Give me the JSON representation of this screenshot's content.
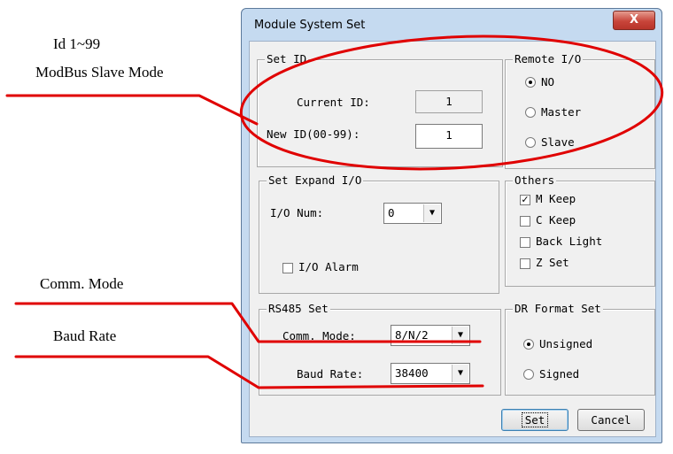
{
  "annotations": {
    "id_range": "Id 1~99",
    "slave_mode": "ModBus Slave Mode",
    "comm_mode": "Comm. Mode",
    "baud_rate": "Baud Rate",
    "line_color": "#e00000"
  },
  "dialog": {
    "title": "Module System Set",
    "close_label": "X",
    "set_id": {
      "title": "Set ID",
      "current_label": "Current ID:",
      "current_value": "1",
      "new_label": "New ID(00-99):",
      "new_value": "1"
    },
    "remote_io": {
      "title": "Remote I/O",
      "options": [
        "NO",
        "Master",
        "Slave"
      ],
      "selected": "NO"
    },
    "expand_io": {
      "title": "Set Expand I/O",
      "num_label": "I/O Num:",
      "num_value": "0",
      "alarm_label": "I/O Alarm"
    },
    "others": {
      "title": "Others",
      "options": [
        "M Keep",
        "C Keep",
        "Back Light",
        "Z Set"
      ],
      "checked": [
        "M Keep"
      ]
    },
    "rs485": {
      "title": "RS485 Set",
      "comm_label": "Comm. Mode:",
      "comm_value": "8/N/2",
      "baud_label": "Baud Rate:",
      "baud_value": "38400"
    },
    "dr_format": {
      "title": "DR Format Set",
      "options": [
        "Unsigned",
        "Signed"
      ],
      "selected": "Unsigned"
    },
    "buttons": {
      "set": "Set",
      "cancel": "Cancel"
    }
  }
}
